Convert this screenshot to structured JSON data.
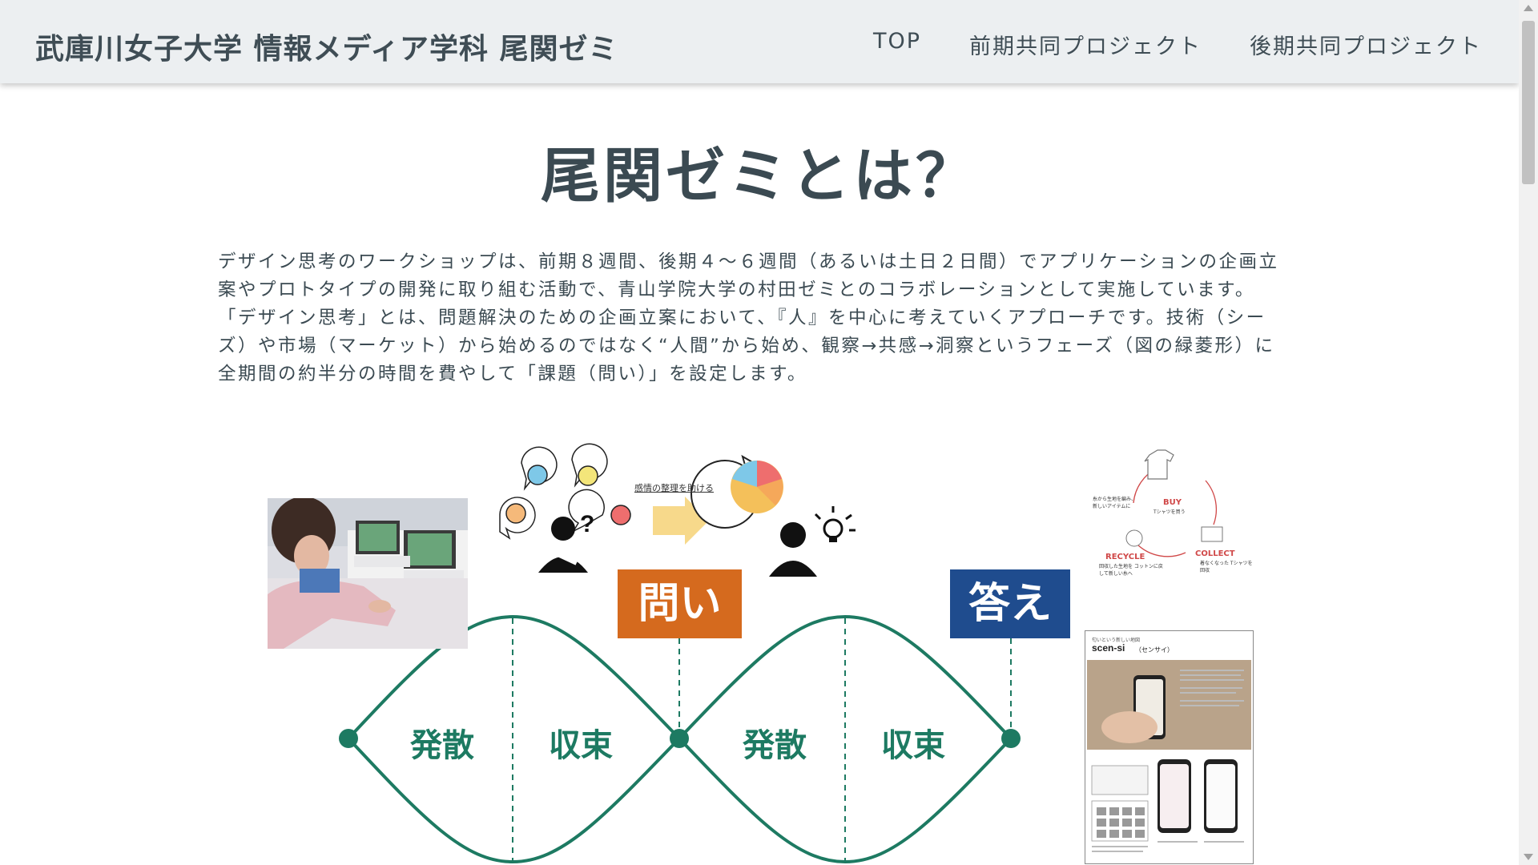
{
  "header": {
    "brand": "武庫川女子大学 情報メディア学科 尾関ゼミ",
    "nav": [
      "TOP",
      "前期共同プロジェクト",
      "後期共同プロジェクト"
    ]
  },
  "main": {
    "title": "尾関ゼミとは？",
    "intro": [
      "デザイン思考のワークショップは、前期８週間、後期４〜６週間（あるいは土日２日間）でアプリケーションの企画立案やプロトタイプの開発に取り組む活動で、青山学院大学の村田ゼミとのコラボレーションとして実施しています。",
      "「デザイン思考」とは、問題解決のための企画立案において、『人』を中心に考えていくアプローチです。技術（シーズ）や市場（マーケット）から始めるのではなく“人間”から始め、観察→共感→洞察というフェーズ（図の緑菱形）に全期間の約半分の時間を費やして「課題（問い）」を設定します。"
    ]
  },
  "diagram": {
    "caption": "感情の整理を助ける",
    "question_label": "問い",
    "answer_label": "答え",
    "phases": [
      "発散",
      "収束",
      "発散",
      "収束"
    ],
    "cycle": {
      "buy": "BUY",
      "buy_sub": "Tシャツを買う",
      "collect": "COLLECT",
      "collect_sub": "着なくなった Tシャツを回収",
      "recycle": "RECYCLE",
      "recycle_sub": "回収した生地を コットンに戻して新しい糸へ",
      "note": "糸から生地を編み、 新しいアイテムに"
    },
    "poster": {
      "tagline": "匂いという新しい地図",
      "title": "scen-si",
      "title_reading": "（センサイ）"
    },
    "colors": {
      "diamond": "#1d7a62",
      "question": "#d56a1e",
      "answer": "#1f4c8e",
      "arrow": "#f7d98b"
    }
  }
}
